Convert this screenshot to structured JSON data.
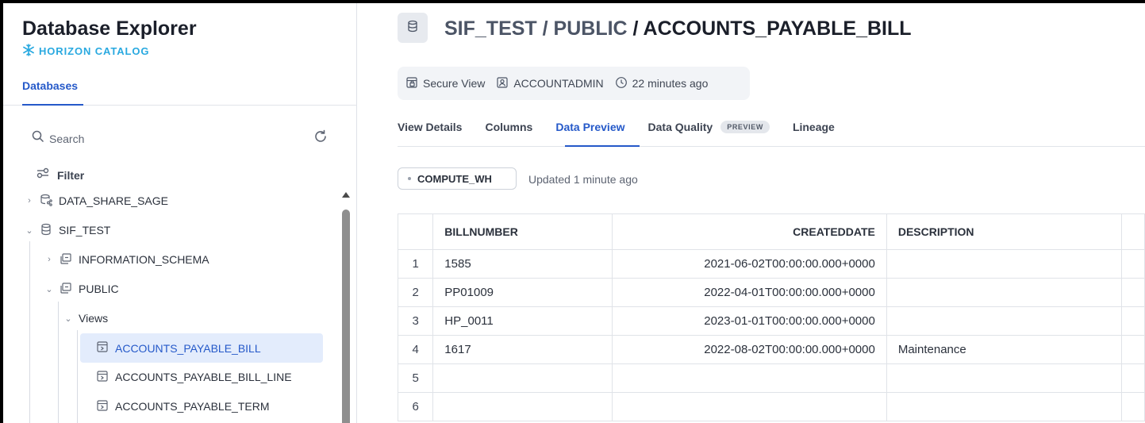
{
  "sidebar": {
    "title": "Database Explorer",
    "catalog_label": "HORIZON CATALOG",
    "tab_label": "Databases",
    "search_placeholder": "Search",
    "filter_label": "Filter",
    "tree": [
      {
        "label": "DATA_SHARE_SAGE",
        "icon": "shared-database-icon",
        "expanded": false
      },
      {
        "label": "SIF_TEST",
        "icon": "database-icon",
        "expanded": true
      },
      {
        "label": "INFORMATION_SCHEMA",
        "icon": "schema-icon",
        "expanded": false
      },
      {
        "label": "PUBLIC",
        "icon": "schema-icon",
        "expanded": true
      },
      {
        "label": "Views",
        "icon": "",
        "expanded": true
      },
      {
        "label": "ACCOUNTS_PAYABLE_BILL",
        "icon": "view-icon",
        "selected": true
      },
      {
        "label": "ACCOUNTS_PAYABLE_BILL_LINE",
        "icon": "view-icon"
      },
      {
        "label": "ACCOUNTS_PAYABLE_TERM",
        "icon": "view-icon"
      }
    ]
  },
  "header": {
    "path_db": "SIF_TEST",
    "path_sep": " / ",
    "path_schema": "PUBLIC",
    "path_object": "ACCOUNTS_PAYABLE_BILL"
  },
  "meta": {
    "type_label": "Secure View",
    "owner": "ACCOUNTADMIN",
    "modified": "22 minutes ago"
  },
  "tabs": [
    {
      "label": "View Details"
    },
    {
      "label": "Columns"
    },
    {
      "label": "Data Preview",
      "active": true
    },
    {
      "label": "Data Quality",
      "badge": "PREVIEW"
    },
    {
      "label": "Lineage"
    }
  ],
  "preview": {
    "warehouse": "COMPUTE_WH",
    "updated": "Updated 1 minute ago"
  },
  "table": {
    "columns": [
      "BILLNUMBER",
      "CREATEDDATE",
      "DESCRIPTION"
    ],
    "rows": [
      {
        "idx": "1",
        "billnumber": "1585",
        "createddate": "2021-06-02T00:00:00.000+0000",
        "description": ""
      },
      {
        "idx": "2",
        "billnumber": "PP01009",
        "createddate": "2022-04-01T00:00:00.000+0000",
        "description": ""
      },
      {
        "idx": "3",
        "billnumber": "HP_0011",
        "createddate": "2023-01-01T00:00:00.000+0000",
        "description": ""
      },
      {
        "idx": "4",
        "billnumber": "1617",
        "createddate": "2022-08-02T00:00:00.000+0000",
        "description": "Maintenance"
      },
      {
        "idx": "5",
        "billnumber": "",
        "createddate": "",
        "description": ""
      },
      {
        "idx": "6",
        "billnumber": "",
        "createddate": "",
        "description": ""
      }
    ]
  },
  "colors": {
    "accent": "#2559c9",
    "catalog": "#29a9e0",
    "selected_bg": "#e3ecfc"
  }
}
